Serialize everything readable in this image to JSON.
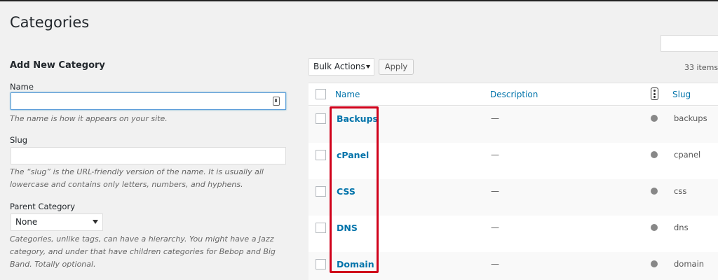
{
  "page": {
    "title": "Categories"
  },
  "form": {
    "title": "Add New Category",
    "name_label": "Name",
    "name_value": "",
    "name_help": "The name is how it appears on your site.",
    "slug_label": "Slug",
    "slug_value": "",
    "slug_help": "The “slug” is the URL-friendly version of the name. It is usually all lowercase and contains only letters, numbers, and hyphens.",
    "parent_label": "Parent Category",
    "parent_selected": "None",
    "parent_help": "Categories, unlike tags, can have a hierarchy. You might have a Jazz category, and under that have children categories for Bebop and Big Band. Totally optional."
  },
  "toolbar": {
    "bulk_actions": "Bulk Actions",
    "apply_label": "Apply",
    "items_count": "33 items"
  },
  "table": {
    "columns": {
      "name": "Name",
      "description": "Description",
      "slug": "Slug"
    },
    "rows": [
      {
        "name": "Backups",
        "description": "—",
        "slug": "backups"
      },
      {
        "name": "cPanel",
        "description": "—",
        "slug": "cpanel"
      },
      {
        "name": "CSS",
        "description": "—",
        "slug": "css"
      },
      {
        "name": "DNS",
        "description": "—",
        "slug": "dns"
      },
      {
        "name": "Domain",
        "description": "—",
        "slug": "domain"
      }
    ]
  },
  "icons": {
    "password_manager": "password-manager-icon",
    "posts_count": "posts-count-icon"
  },
  "colors": {
    "link": "#0073aa",
    "highlight": "#d0021b",
    "focus": "#5b9dd9"
  }
}
